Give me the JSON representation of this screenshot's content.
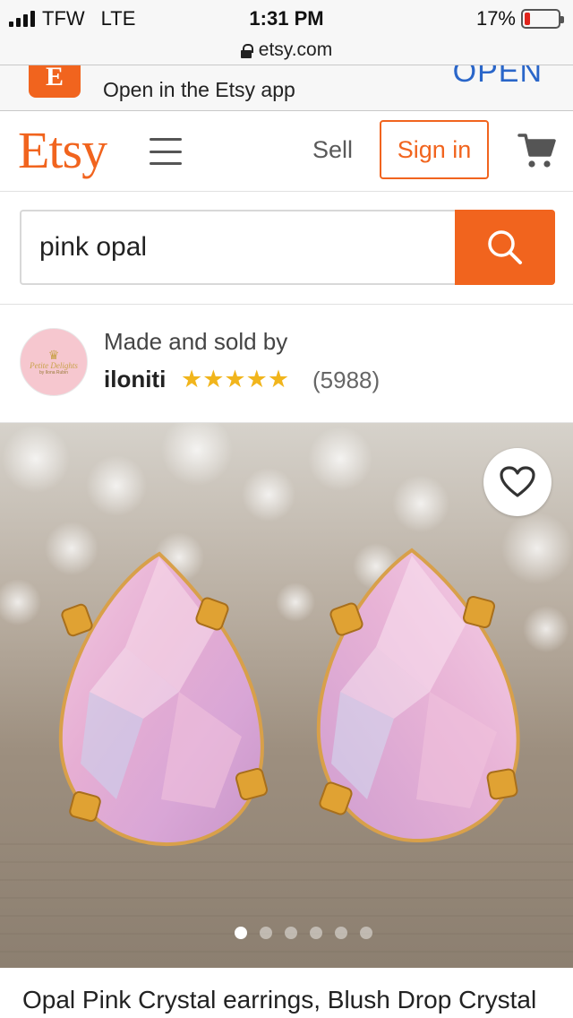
{
  "status_bar": {
    "carrier": "TFW",
    "network": "LTE",
    "time": "1:31 PM",
    "battery_percent": "17%",
    "battery_level": 0.17,
    "battery_color": "#e0241c"
  },
  "url_bar": {
    "domain": "etsy.com",
    "icon": "lock-icon"
  },
  "app_banner": {
    "icon_letter": "E",
    "text": "Open in the Etsy app",
    "action": "OPEN"
  },
  "header": {
    "logo": "Etsy",
    "menu_icon": "hamburger-menu-icon",
    "sell_label": "Sell",
    "signin_label": "Sign in",
    "cart_icon": "shopping-cart-icon"
  },
  "search": {
    "value": "pink opal",
    "icon": "search-icon"
  },
  "shop": {
    "made_by_label": "Made and sold by",
    "name": "iloniti",
    "rating_stars": "★★★★★",
    "rating": 5,
    "review_count": "(5988)",
    "avatar_text": "Petite Delights",
    "avatar_subtext": "by Ilona Rubin"
  },
  "product": {
    "image_alt": "Pink opal teardrop crystal stud earrings in gold prong settings",
    "favorite_icon": "heart-icon",
    "image_count": 6,
    "active_image": 1,
    "title": "Opal Pink Crystal earrings, Blush Drop Crystal"
  },
  "colors": {
    "accent": "#f1641e",
    "star": "#f1b51c",
    "banner_link": "#2a66c9"
  }
}
